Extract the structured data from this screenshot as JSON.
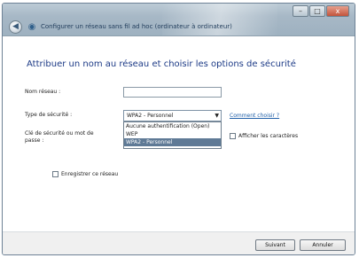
{
  "window": {
    "title": "Configurer un réseau sans fil ad hoc (ordinateur à ordinateur)"
  },
  "heading": "Attribuer un nom au réseau et choisir les options de sécurité",
  "form": {
    "network_name_label": "Nom réseau :",
    "network_name_value": "",
    "security_type_label": "Type de sécurité :",
    "security_type_value": "WPA2 - Personnel",
    "security_options": [
      "Aucune authentification (Open)",
      "WEP",
      "WPA2 - Personnel"
    ],
    "help_link": "Comment choisir ?",
    "security_key_label_line1": "Clé de sécurité ou mot de",
    "security_key_label_line2": "passe :",
    "show_chars_label": "Afficher les caractères",
    "save_network_label": "Enregistrer ce réseau"
  },
  "buttons": {
    "next": "Suivant",
    "cancel": "Annuler"
  },
  "caption_buttons": {
    "minimize": "–",
    "maximize": "□",
    "close": "x"
  },
  "icons": {
    "back": "back-arrow-icon",
    "network": "wireless-network-icon"
  }
}
